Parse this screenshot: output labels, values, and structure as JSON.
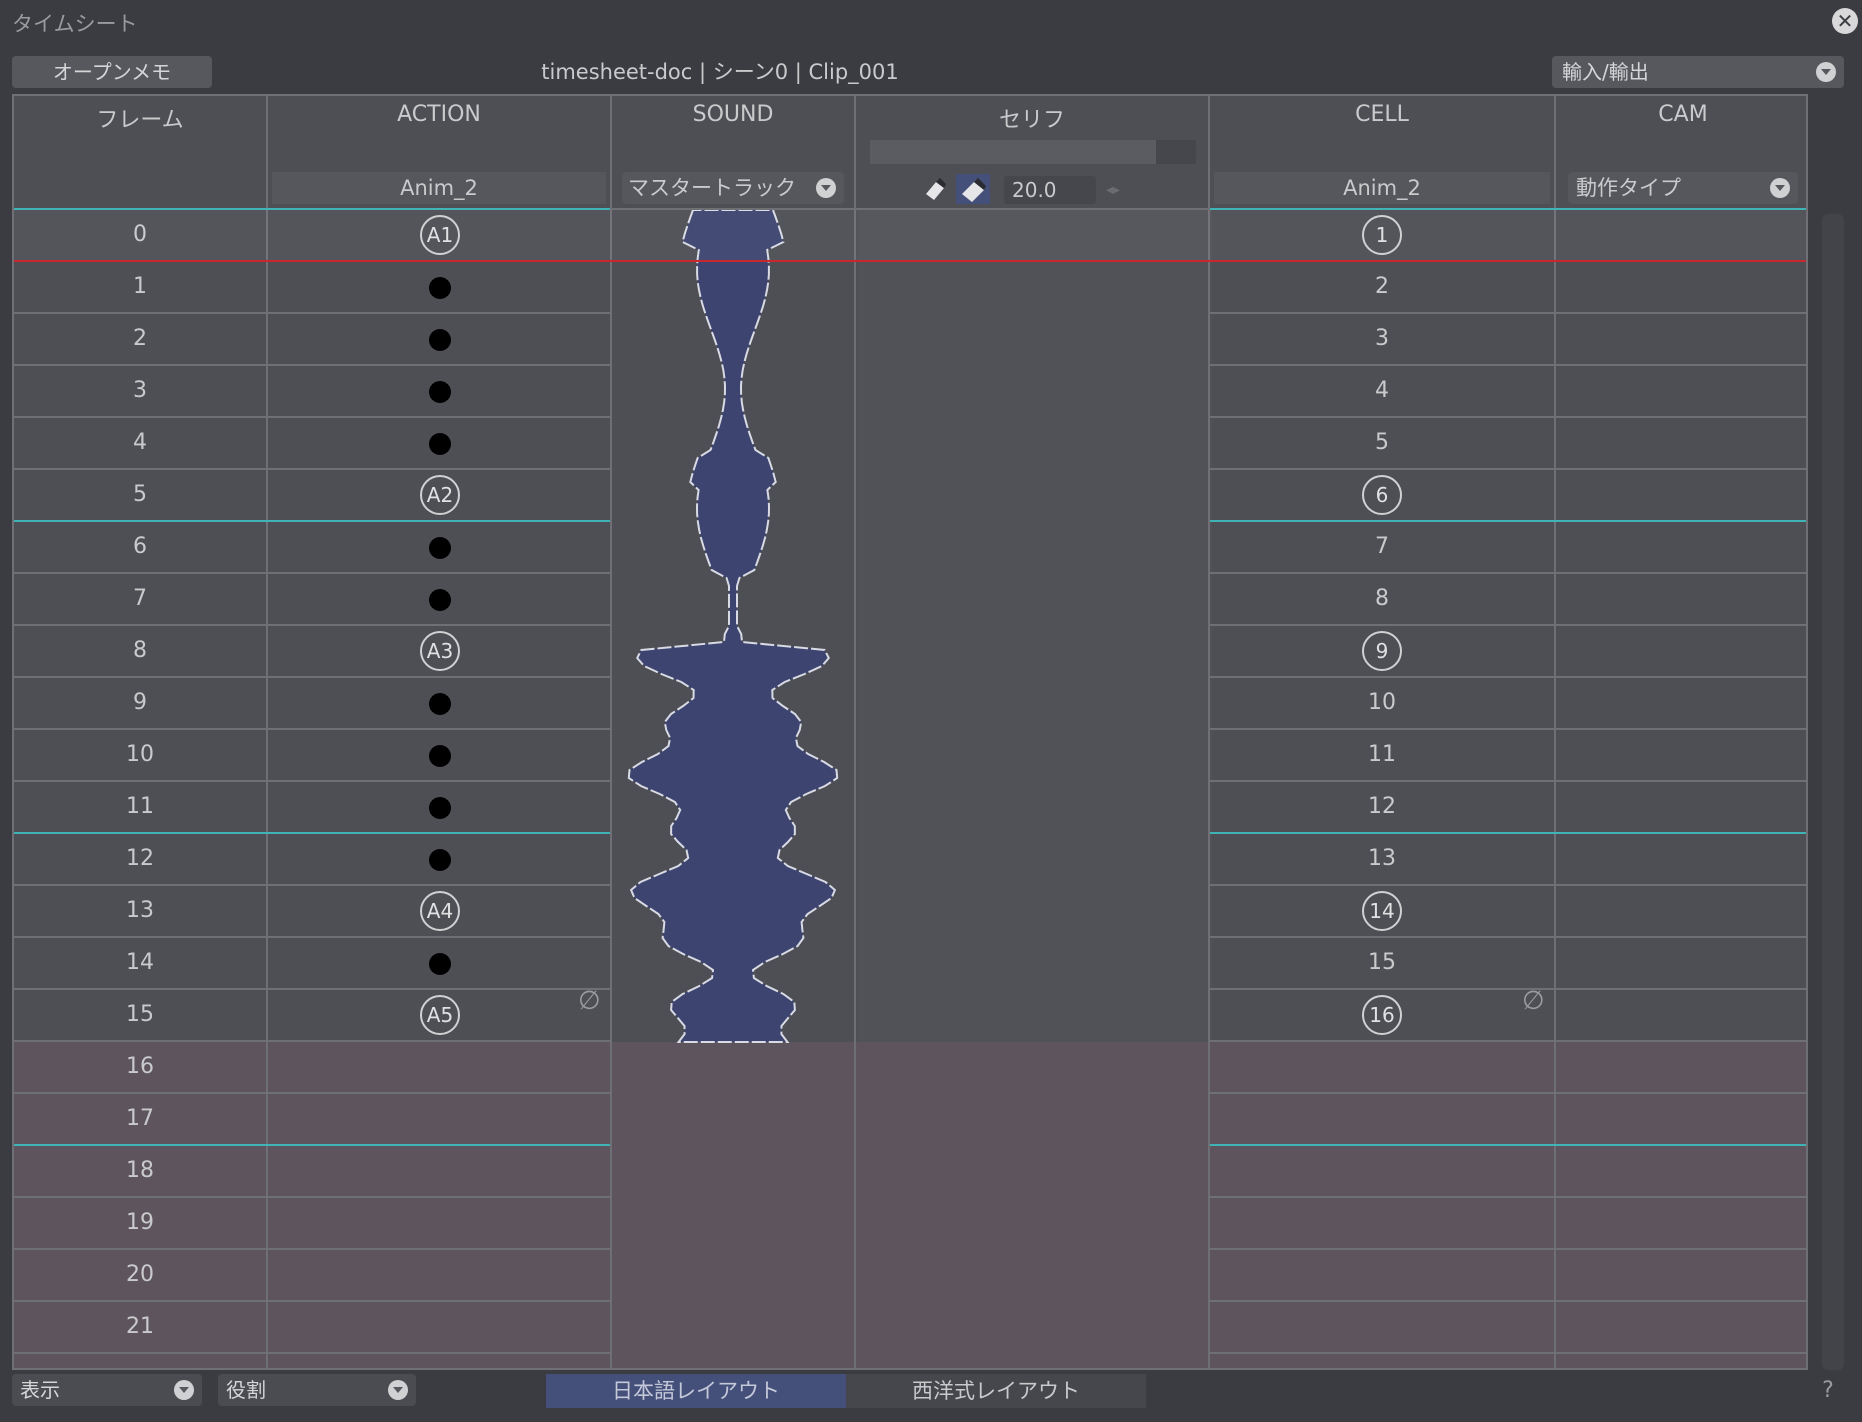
{
  "window": {
    "title": "タイムシート",
    "close_icon": "close-icon"
  },
  "toolbar": {
    "memo_button": "オープンメモ",
    "doc_path": "timesheet-doc | シーン0 | Clip_001",
    "io_select": "輸入/輸出"
  },
  "columns": {
    "frame": {
      "title": "フレーム"
    },
    "action": {
      "title": "ACTION",
      "sub": "Anim_2"
    },
    "sound": {
      "title": "SOUND",
      "select": "マスタートラック"
    },
    "serif": {
      "title": "セリフ",
      "value": "20.0",
      "brush_icon": "brush-icon",
      "eraser_icon": "eraser-icon"
    },
    "cell": {
      "title": "CELL",
      "sub": "Anim_2"
    },
    "cam": {
      "title": "CAM",
      "select": "動作タイプ"
    }
  },
  "frames": [
    "0",
    "1",
    "2",
    "3",
    "4",
    "5",
    "6",
    "7",
    "8",
    "9",
    "10",
    "11",
    "12",
    "13",
    "14",
    "15",
    "16",
    "17",
    "18",
    "19",
    "20",
    "21"
  ],
  "action_marks": [
    "A1",
    "●",
    "●",
    "●",
    "●",
    "A2",
    "●",
    "●",
    "A3",
    "●",
    "●",
    "●",
    "●",
    "A4",
    "●",
    "A5"
  ],
  "cell_marks": [
    "1",
    "2",
    "3",
    "4",
    "5",
    "6",
    "7",
    "8",
    "9",
    "10",
    "11",
    "12",
    "13",
    "14",
    "15",
    "16"
  ],
  "cell_keyframes": [
    "1",
    "6",
    "9",
    "14",
    "16"
  ],
  "empty_symbol": "∅",
  "footer": {
    "view_select": "表示",
    "role_select": "役割",
    "layout_jp": "日本語レイアウト",
    "layout_west": "西洋式レイアウト",
    "help": "?"
  },
  "colors": {
    "cyan": "#3fb3b5",
    "red": "#c8282d",
    "active_bg": "#4d4f54",
    "inactive_bg": "#5e545d",
    "waveform": "#3d4470"
  }
}
